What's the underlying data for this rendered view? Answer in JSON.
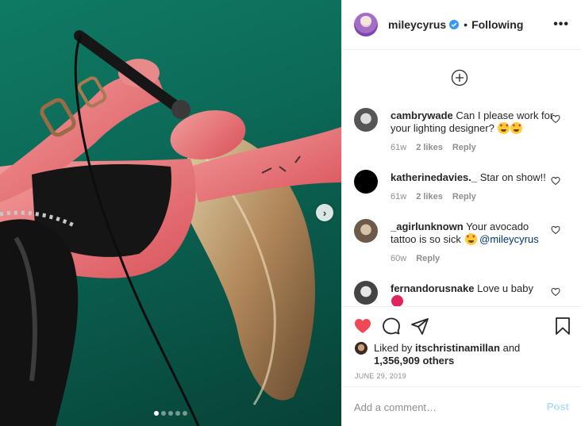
{
  "post": {
    "username": "mileycyrus",
    "follow_state": "Following",
    "separator": "•",
    "more_label": "•••",
    "date": "JUNE 29, 2019",
    "carousel": {
      "total": 5,
      "active": 1
    }
  },
  "comments": [
    {
      "user": "cambrywade",
      "text": "Can I please work for your lighting designer?",
      "emoji_count": 2,
      "time": "61w",
      "likes": "2 likes",
      "reply": "Reply"
    },
    {
      "user": "katherinedavies._",
      "text": "Star on show!!",
      "emoji_count": 0,
      "time": "61w",
      "likes": "2 likes",
      "reply": "Reply"
    },
    {
      "user": "_agirlunknown",
      "text": "Your avocado tattoo is so sick",
      "mention": "@mileycyrus",
      "emoji_count": 1,
      "time": "60w",
      "reply": "Reply"
    },
    {
      "user": "fernandorusnake",
      "text": "Love u baby"
    }
  ],
  "likes": {
    "prefix": "Liked by",
    "user": "itschristinamillan",
    "connector": "and",
    "count": "1,356,909 others"
  },
  "composer": {
    "placeholder": "Add a comment…",
    "post_label": "Post"
  },
  "colors": {
    "like_red": "#ed4956",
    "verified_blue": "#3897f0",
    "post_disabled": "#b2dffc"
  },
  "icons": {
    "like": "heart-filled-icon",
    "comment": "comment-bubble-icon",
    "share": "paper-plane-icon",
    "save": "bookmark-icon",
    "load_more": "plus-circle-icon",
    "next": "chevron-right-icon"
  }
}
